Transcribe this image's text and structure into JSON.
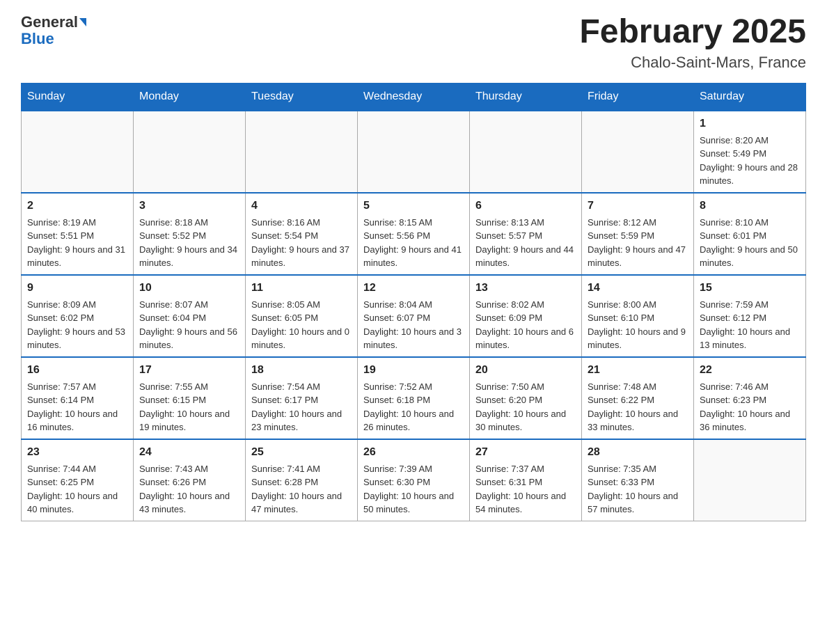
{
  "header": {
    "logo_line1": "General",
    "logo_line2": "Blue",
    "month_title": "February 2025",
    "location": "Chalo-Saint-Mars, France"
  },
  "weekdays": [
    "Sunday",
    "Monday",
    "Tuesday",
    "Wednesday",
    "Thursday",
    "Friday",
    "Saturday"
  ],
  "weeks": [
    [
      {
        "day": "",
        "info": ""
      },
      {
        "day": "",
        "info": ""
      },
      {
        "day": "",
        "info": ""
      },
      {
        "day": "",
        "info": ""
      },
      {
        "day": "",
        "info": ""
      },
      {
        "day": "",
        "info": ""
      },
      {
        "day": "1",
        "info": "Sunrise: 8:20 AM\nSunset: 5:49 PM\nDaylight: 9 hours and 28 minutes."
      }
    ],
    [
      {
        "day": "2",
        "info": "Sunrise: 8:19 AM\nSunset: 5:51 PM\nDaylight: 9 hours and 31 minutes."
      },
      {
        "day": "3",
        "info": "Sunrise: 8:18 AM\nSunset: 5:52 PM\nDaylight: 9 hours and 34 minutes."
      },
      {
        "day": "4",
        "info": "Sunrise: 8:16 AM\nSunset: 5:54 PM\nDaylight: 9 hours and 37 minutes."
      },
      {
        "day": "5",
        "info": "Sunrise: 8:15 AM\nSunset: 5:56 PM\nDaylight: 9 hours and 41 minutes."
      },
      {
        "day": "6",
        "info": "Sunrise: 8:13 AM\nSunset: 5:57 PM\nDaylight: 9 hours and 44 minutes."
      },
      {
        "day": "7",
        "info": "Sunrise: 8:12 AM\nSunset: 5:59 PM\nDaylight: 9 hours and 47 minutes."
      },
      {
        "day": "8",
        "info": "Sunrise: 8:10 AM\nSunset: 6:01 PM\nDaylight: 9 hours and 50 minutes."
      }
    ],
    [
      {
        "day": "9",
        "info": "Sunrise: 8:09 AM\nSunset: 6:02 PM\nDaylight: 9 hours and 53 minutes."
      },
      {
        "day": "10",
        "info": "Sunrise: 8:07 AM\nSunset: 6:04 PM\nDaylight: 9 hours and 56 minutes."
      },
      {
        "day": "11",
        "info": "Sunrise: 8:05 AM\nSunset: 6:05 PM\nDaylight: 10 hours and 0 minutes."
      },
      {
        "day": "12",
        "info": "Sunrise: 8:04 AM\nSunset: 6:07 PM\nDaylight: 10 hours and 3 minutes."
      },
      {
        "day": "13",
        "info": "Sunrise: 8:02 AM\nSunset: 6:09 PM\nDaylight: 10 hours and 6 minutes."
      },
      {
        "day": "14",
        "info": "Sunrise: 8:00 AM\nSunset: 6:10 PM\nDaylight: 10 hours and 9 minutes."
      },
      {
        "day": "15",
        "info": "Sunrise: 7:59 AM\nSunset: 6:12 PM\nDaylight: 10 hours and 13 minutes."
      }
    ],
    [
      {
        "day": "16",
        "info": "Sunrise: 7:57 AM\nSunset: 6:14 PM\nDaylight: 10 hours and 16 minutes."
      },
      {
        "day": "17",
        "info": "Sunrise: 7:55 AM\nSunset: 6:15 PM\nDaylight: 10 hours and 19 minutes."
      },
      {
        "day": "18",
        "info": "Sunrise: 7:54 AM\nSunset: 6:17 PM\nDaylight: 10 hours and 23 minutes."
      },
      {
        "day": "19",
        "info": "Sunrise: 7:52 AM\nSunset: 6:18 PM\nDaylight: 10 hours and 26 minutes."
      },
      {
        "day": "20",
        "info": "Sunrise: 7:50 AM\nSunset: 6:20 PM\nDaylight: 10 hours and 30 minutes."
      },
      {
        "day": "21",
        "info": "Sunrise: 7:48 AM\nSunset: 6:22 PM\nDaylight: 10 hours and 33 minutes."
      },
      {
        "day": "22",
        "info": "Sunrise: 7:46 AM\nSunset: 6:23 PM\nDaylight: 10 hours and 36 minutes."
      }
    ],
    [
      {
        "day": "23",
        "info": "Sunrise: 7:44 AM\nSunset: 6:25 PM\nDaylight: 10 hours and 40 minutes."
      },
      {
        "day": "24",
        "info": "Sunrise: 7:43 AM\nSunset: 6:26 PM\nDaylight: 10 hours and 43 minutes."
      },
      {
        "day": "25",
        "info": "Sunrise: 7:41 AM\nSunset: 6:28 PM\nDaylight: 10 hours and 47 minutes."
      },
      {
        "day": "26",
        "info": "Sunrise: 7:39 AM\nSunset: 6:30 PM\nDaylight: 10 hours and 50 minutes."
      },
      {
        "day": "27",
        "info": "Sunrise: 7:37 AM\nSunset: 6:31 PM\nDaylight: 10 hours and 54 minutes."
      },
      {
        "day": "28",
        "info": "Sunrise: 7:35 AM\nSunset: 6:33 PM\nDaylight: 10 hours and 57 minutes."
      },
      {
        "day": "",
        "info": ""
      }
    ]
  ]
}
